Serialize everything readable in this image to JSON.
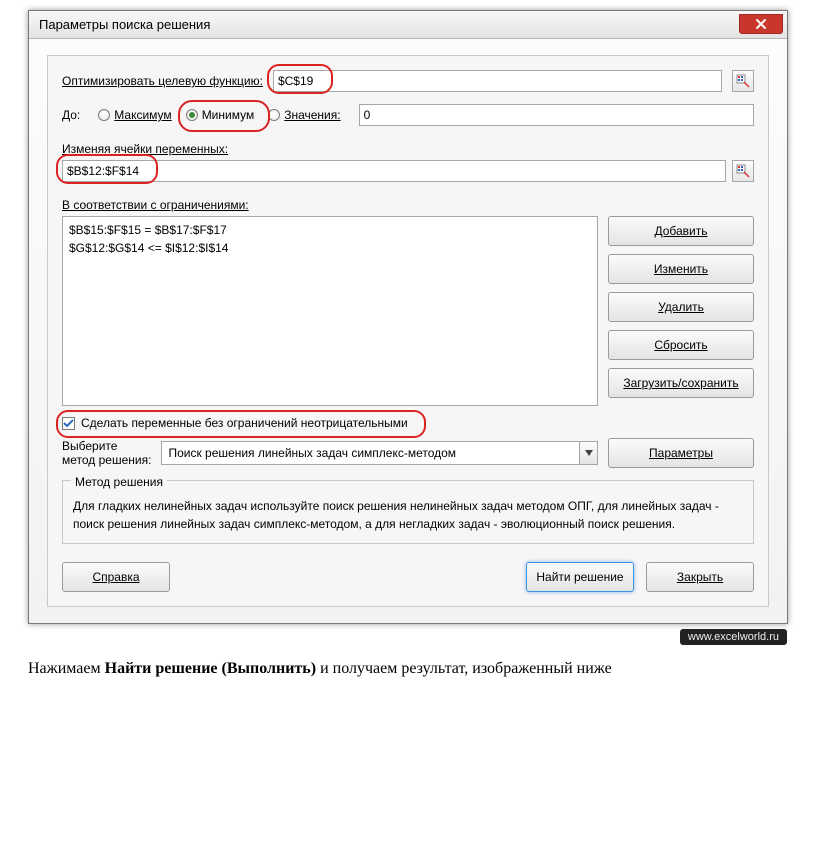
{
  "window": {
    "title": "Параметры поиска решения"
  },
  "objective": {
    "label": "Оптимизировать целевую функцию:",
    "value": "$C$19"
  },
  "to": {
    "label": "До:",
    "max": "Максимум",
    "min": "Минимум",
    "value_label": "Значения:",
    "value_field": "0",
    "selected": "min"
  },
  "vars": {
    "label": "Изменяя ячейки переменных:",
    "value": "$B$12:$F$14"
  },
  "constraints": {
    "label": "В соответствии с ограничениями:",
    "lines": [
      "$B$15:$F$15 = $B$17:$F$17",
      "$G$12:$G$14 <= $I$12:$I$14"
    ]
  },
  "buttons": {
    "add": "Добавить",
    "change": "Изменить",
    "delete": "Удалить",
    "reset": "Сбросить",
    "loadsave": "Загрузить/сохранить",
    "params": "Параметры",
    "help": "Справка",
    "solve": "Найти решение",
    "close": "Закрыть"
  },
  "nonneg": {
    "label": "Сделать переменные без ограничений неотрицательными",
    "checked": true
  },
  "method": {
    "label_line1": "Выберите",
    "label_line2": "метод решения:",
    "selected": "Поиск решения линейных задач симплекс-методом"
  },
  "methodbox": {
    "legend": "Метод решения",
    "text": "Для гладких нелинейных задач используйте поиск решения нелинейных задач методом ОПГ, для линейных задач - поиск решения линейных задач симплекс-методом, а для негладких задач - эволюционный поиск решения."
  },
  "watermark": "www.excelworld.ru",
  "caption": {
    "prefix": "Нажимаем ",
    "bold": "Найти решение (Выполнить)",
    "suffix": " и получаем результат, изображенный ниже"
  }
}
